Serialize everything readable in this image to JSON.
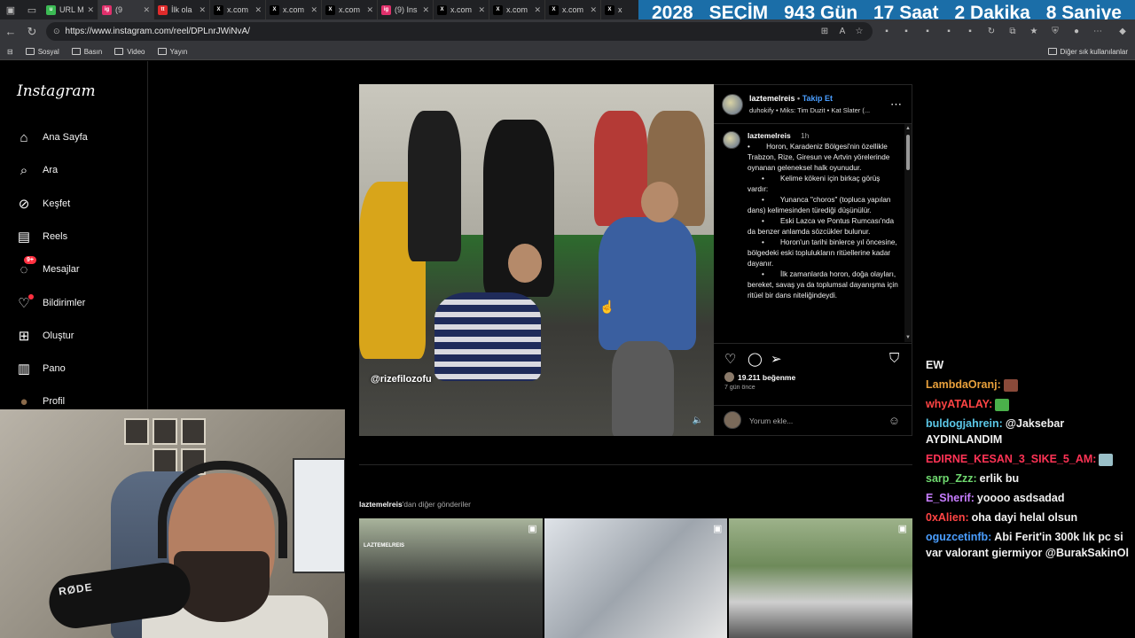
{
  "browser": {
    "tabs": [
      {
        "title": "URL M",
        "icon": "u",
        "color": "#3cba54"
      },
      {
        "title": "(9",
        "icon": "ig",
        "color": "#e1306c"
      },
      {
        "title": "İlk ola",
        "icon": "tt",
        "color": "#e02b2b"
      },
      {
        "title": "x.com",
        "icon": "X",
        "color": "#000000"
      },
      {
        "title": "x.com",
        "icon": "X",
        "color": "#000000"
      },
      {
        "title": "x.com",
        "icon": "X",
        "color": "#000000"
      },
      {
        "title": "(9) Ins",
        "icon": "ig",
        "color": "#e1306c"
      },
      {
        "title": "x.com",
        "icon": "X",
        "color": "#000000"
      },
      {
        "title": "x.com",
        "icon": "X",
        "color": "#000000"
      },
      {
        "title": "x.com",
        "icon": "X",
        "color": "#000000"
      },
      {
        "title": "x",
        "icon": "X",
        "color": "#000000"
      }
    ],
    "url": "https://www.instagram.com/reel/DPLnrJWiNvA/",
    "bookmarks": [
      "Sosyal",
      "Basın",
      "Video",
      "Yayın"
    ],
    "other_bookmarks": "Diğer sık kullanılanlar"
  },
  "countdown": {
    "year": "2028",
    "label": "SEÇİM",
    "days": "943 Gün",
    "hours": "17 Saat",
    "minutes": "2 Dakika",
    "seconds": "8 Saniye"
  },
  "instagram": {
    "logo": "Instagram",
    "nav": [
      {
        "label": "Ana Sayfa",
        "icon": "home-icon"
      },
      {
        "label": "Ara",
        "icon": "search-icon"
      },
      {
        "label": "Keşfet",
        "icon": "compass-icon"
      },
      {
        "label": "Reels",
        "icon": "reels-icon"
      },
      {
        "label": "Mesajlar",
        "icon": "messenger-icon",
        "badge": "9+"
      },
      {
        "label": "Bildirimler",
        "icon": "heart-icon"
      },
      {
        "label": "Oluştur",
        "icon": "plus-square-icon"
      },
      {
        "label": "Pano",
        "icon": "dashboard-icon"
      },
      {
        "label": "Profil",
        "icon": "profile-icon"
      }
    ],
    "post": {
      "username": "laztemelreis",
      "follow_label": "Takip Et",
      "audio": "duhokify • Miks: Tim Duzit • Kat Slater (...",
      "watermark": "@rizefilozofu",
      "caption_user": "laztemelreis",
      "caption_time": "1h",
      "caption": "•        Horon, Karadeniz Bölgesi'nin özellikle Trabzon, Rize, Giresun ve Artvin yörelerinde oynanan geleneksel halk oyunudur.\n       •        Kelime kökeni için birkaç görüş vardır:\n       •        Yunanca \"choros\" (topluca yapılan dans) kelimesinden türediği düşünülür.\n       •        Eski Lazca ve Pontus Rumcası'nda da benzer anlamda sözcükler bulunur.\n       •        Horon'un tarihi binlerce yıl öncesine, bölgedeki eski toplulukların ritüellerine kadar dayanır.\n       •        İlk zamanlarda horon, doğa olayları, bereket, savaş ya da toplumsal dayanışma için ritüel bir dans niteliğindeydi.",
      "likes": "19.211 beğenme",
      "ago": "7 gün önce",
      "comment_placeholder": "Yorum ekle..."
    },
    "more_from_user": "laztemelreis",
    "more_from_suffix": "'dan diğer gönderiler",
    "thumb_label": "LAZTEMELREIS"
  },
  "webcam": {
    "mic_brand": "RØDE"
  },
  "chat": [
    {
      "nick": "",
      "text": "EW",
      "color": "#ffffff"
    },
    {
      "nick": "LambdaOranj:",
      "text": "",
      "color": "#e8a03c",
      "emote": true
    },
    {
      "nick": "whyATALAY:",
      "text": "",
      "color": "#ff4444",
      "emote": true
    },
    {
      "nick": "buldogjahrein:",
      "text": "@Jaksebar AYDINLANDIM",
      "color": "#5cc8e8"
    },
    {
      "nick": "EDIRNE_KESAN_3_SIKE_5_AM:",
      "text": "",
      "color": "#ff3355",
      "emote": true
    },
    {
      "nick": "sarp_Zzz:",
      "text": "erlik bu",
      "color": "#6fd96f"
    },
    {
      "nick": "E_Sherif:",
      "text": "yoooo asdsadad",
      "color": "#c77dff"
    },
    {
      "nick": "0xAlien:",
      "text": "oha dayi helal olsun",
      "color": "#ff4444"
    },
    {
      "nick": "oguzcetinfb:",
      "text": "Abi Ferit'in 300k lık pc si var valorant giermiyor @BurakSakinOl",
      "color": "#4a9eff"
    }
  ]
}
